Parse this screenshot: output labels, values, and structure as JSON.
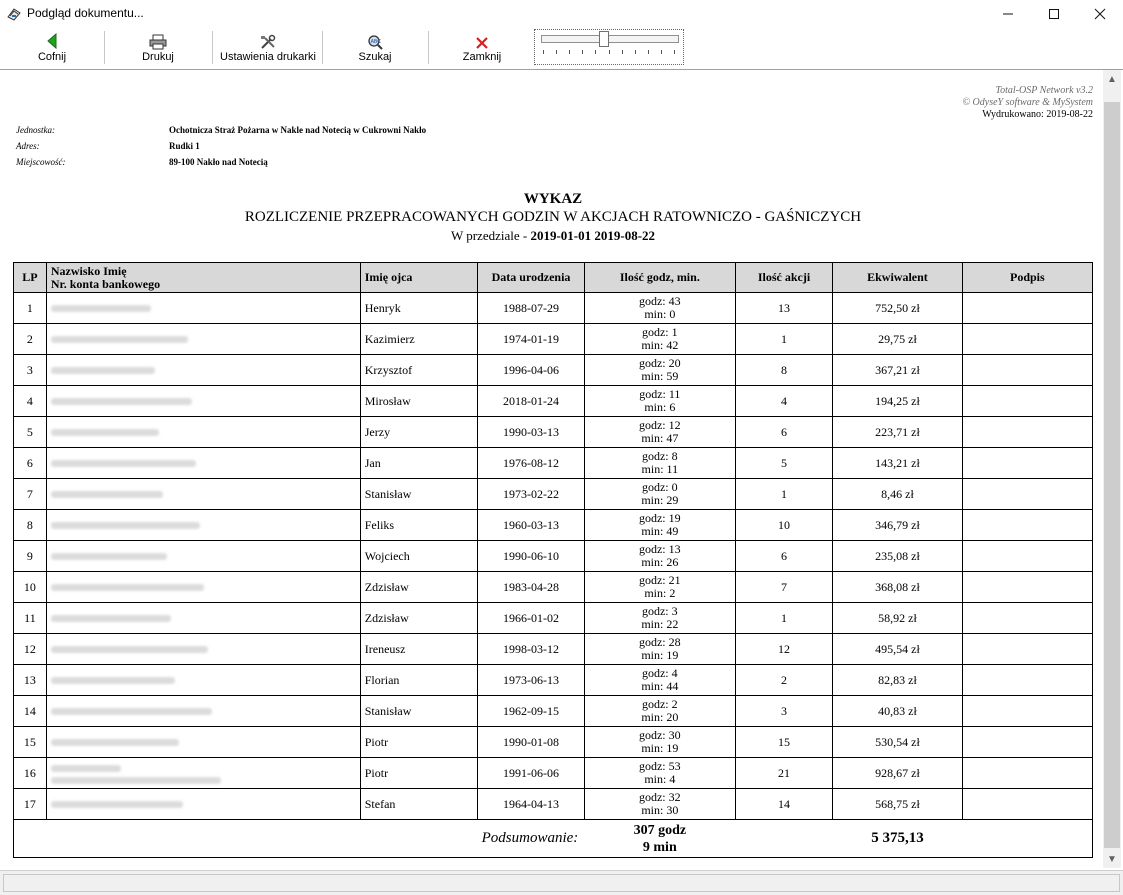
{
  "window": {
    "title": "Podgląd dokumentu..."
  },
  "toolbar": {
    "back_label": "Cofnij",
    "print_label": "Drukuj",
    "printer_settings_label": "Ustawienia drukarki",
    "search_label": "Szukaj",
    "close_label": "Zamknij",
    "zoom_level": 0.45
  },
  "report": {
    "brand_line1": "Total-OSP Network v3.2",
    "brand_line2": "© OdyseY software & MySystem",
    "printed_label": "Wydrukowano:",
    "printed_date": "2019-08-22",
    "unit_label": "Jednostka:",
    "unit_value": "Ochotnicza Straż Pożarna w Nakle nad Notecią w Cukrowni Nakło",
    "address_label": "Adres:",
    "address_value": "Rudki 1",
    "city_label": "Miejscowość:",
    "city_value": "89-100 Nakło nad Notecią",
    "title": "WYKAZ",
    "subtitle": "ROZLICZENIE PRZEPRACOWANYCH GODZIN W AKCJACH RATOWNICZO - GAŚNICZYCH",
    "range_prefix": "W przedziale - ",
    "range_value": "2019-01-01 2019-08-22",
    "columns": {
      "lp": "LP",
      "name_line1": "Nazwisko Imię",
      "name_line2": "Nr. konta bankowego",
      "father": "Imię ojca",
      "birth": "Data urodzenia",
      "hours": "Ilość godz, min.",
      "actions": "Ilość akcji",
      "equiv": "Ekwiwalent",
      "sign": "Podpis"
    },
    "rows": [
      {
        "lp": "1",
        "father": "Henryk",
        "birth": "1988-07-29",
        "hours": "godz: 43",
        "minutes": "min: 0",
        "actions": "13",
        "equiv": "752,50 zł"
      },
      {
        "lp": "2",
        "father": "Kazimierz",
        "birth": "1974-01-19",
        "hours": "godz: 1",
        "minutes": "min: 42",
        "actions": "1",
        "equiv": "29,75 zł"
      },
      {
        "lp": "3",
        "father": "Krzysztof",
        "birth": "1996-04-06",
        "hours": "godz: 20",
        "minutes": "min: 59",
        "actions": "8",
        "equiv": "367,21 zł"
      },
      {
        "lp": "4",
        "father": "Mirosław",
        "birth": "2018-01-24",
        "hours": "godz: 11",
        "minutes": "min: 6",
        "actions": "4",
        "equiv": "194,25 zł"
      },
      {
        "lp": "5",
        "father": "Jerzy",
        "birth": "1990-03-13",
        "hours": "godz: 12",
        "minutes": "min: 47",
        "actions": "6",
        "equiv": "223,71 zł"
      },
      {
        "lp": "6",
        "father": "Jan",
        "birth": "1976-08-12",
        "hours": "godz: 8",
        "minutes": "min: 11",
        "actions": "5",
        "equiv": "143,21 zł"
      },
      {
        "lp": "7",
        "father": "Stanisław",
        "birth": "1973-02-22",
        "hours": "godz: 0",
        "minutes": "min: 29",
        "actions": "1",
        "equiv": "8,46 zł"
      },
      {
        "lp": "8",
        "father": "Feliks",
        "birth": "1960-03-13",
        "hours": "godz: 19",
        "minutes": "min: 49",
        "actions": "10",
        "equiv": "346,79 zł"
      },
      {
        "lp": "9",
        "father": "Wojciech",
        "birth": "1990-06-10",
        "hours": "godz: 13",
        "minutes": "min: 26",
        "actions": "6",
        "equiv": "235,08 zł"
      },
      {
        "lp": "10",
        "father": "Zdzisław",
        "birth": "1983-04-28",
        "hours": "godz: 21",
        "minutes": "min: 2",
        "actions": "7",
        "equiv": "368,08 zł"
      },
      {
        "lp": "11",
        "father": "Zdzisław",
        "birth": "1966-01-02",
        "hours": "godz: 3",
        "minutes": "min: 22",
        "actions": "1",
        "equiv": "58,92 zł"
      },
      {
        "lp": "12",
        "father": "Ireneusz",
        "birth": "1998-03-12",
        "hours": "godz: 28",
        "minutes": "min: 19",
        "actions": "12",
        "equiv": "495,54 zł"
      },
      {
        "lp": "13",
        "father": "Florian",
        "birth": "1973-06-13",
        "hours": "godz: 4",
        "minutes": "min: 44",
        "actions": "2",
        "equiv": "82,83 zł"
      },
      {
        "lp": "14",
        "father": "Stanisław",
        "birth": "1962-09-15",
        "hours": "godz: 2",
        "minutes": "min: 20",
        "actions": "3",
        "equiv": "40,83 zł"
      },
      {
        "lp": "15",
        "father": "Piotr",
        "birth": "1990-01-08",
        "hours": "godz: 30",
        "minutes": "min: 19",
        "actions": "15",
        "equiv": "530,54 zł"
      },
      {
        "lp": "16",
        "father": "Piotr",
        "birth": "1991-06-06",
        "hours": "godz: 53",
        "minutes": "min: 4",
        "actions": "21",
        "equiv": "928,67 zł"
      },
      {
        "lp": "17",
        "father": "Stefan",
        "birth": "1964-04-13",
        "hours": "godz: 32",
        "minutes": "min: 30",
        "actions": "14",
        "equiv": "568,75 zł"
      }
    ],
    "summary_label": "Podsumowanie:",
    "summary_hours": "307 godz",
    "summary_minutes": "9 min",
    "summary_total": "5 375,13"
  }
}
